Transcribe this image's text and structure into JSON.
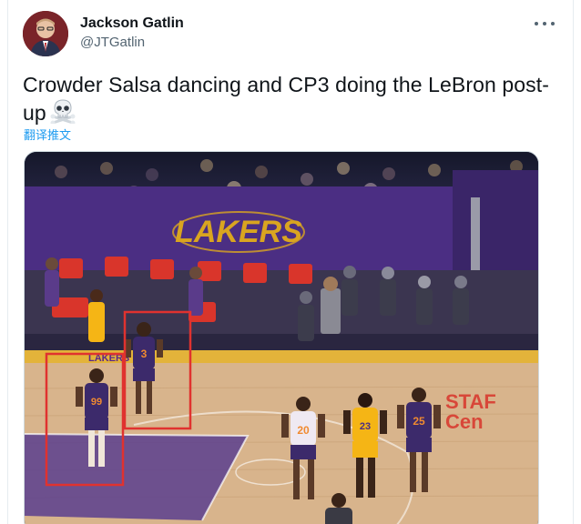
{
  "author": {
    "display_name": "Jackson Gatlin",
    "handle": "@JTGatlin",
    "avatar_icon": "user-avatar"
  },
  "tweet": {
    "text": "Crowder Salsa dancing and CP3 doing the LeBron post-up",
    "emoji_icon": "skull-crossbones-icon",
    "translate_label": "翻译推文",
    "more_icon": "more-options-icon"
  },
  "media": {
    "scene": "basketball-court",
    "banner_text": "LAKERS",
    "sponsor_text": "STAF",
    "sponsor_text_2": "Cen",
    "floor_text": "LAKERS",
    "jerseys": [
      "99",
      "3",
      "20",
      "25",
      "23"
    ],
    "highlight_color": "#e0322f",
    "accent_colors": {
      "lakers_purple": "#4b2e83",
      "lakers_gold": "#f5b515",
      "court_wood": "#d8b48c",
      "suns_purple": "#3c2a6b",
      "gatorade_red": "#d9352b"
    }
  }
}
